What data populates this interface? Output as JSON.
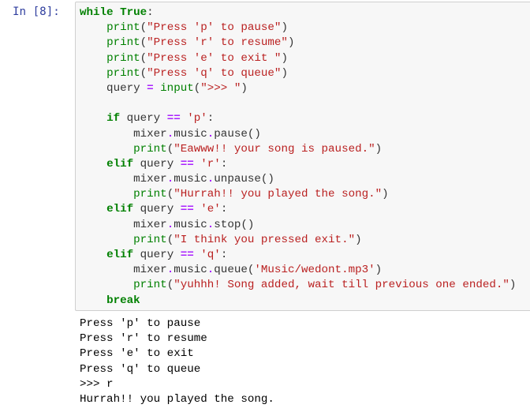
{
  "cell": {
    "prompt": "In [8]:",
    "code_lines": [
      [
        {
          "t": "kw",
          "v": "while"
        },
        {
          "t": "tx",
          "v": " "
        },
        {
          "t": "kw",
          "v": "True"
        },
        {
          "t": "tx",
          "v": ":"
        }
      ],
      [
        {
          "t": "tx",
          "v": "    "
        },
        {
          "t": "bi",
          "v": "print"
        },
        {
          "t": "tx",
          "v": "("
        },
        {
          "t": "st",
          "v": "\"Press 'p' to pause\""
        },
        {
          "t": "tx",
          "v": ")"
        }
      ],
      [
        {
          "t": "tx",
          "v": "    "
        },
        {
          "t": "bi",
          "v": "print"
        },
        {
          "t": "tx",
          "v": "("
        },
        {
          "t": "st",
          "v": "\"Press 'r' to resume\""
        },
        {
          "t": "tx",
          "v": ")"
        }
      ],
      [
        {
          "t": "tx",
          "v": "    "
        },
        {
          "t": "bi",
          "v": "print"
        },
        {
          "t": "tx",
          "v": "("
        },
        {
          "t": "st",
          "v": "\"Press 'e' to exit \""
        },
        {
          "t": "tx",
          "v": ")"
        }
      ],
      [
        {
          "t": "tx",
          "v": "    "
        },
        {
          "t": "bi",
          "v": "print"
        },
        {
          "t": "tx",
          "v": "("
        },
        {
          "t": "st",
          "v": "\"Press 'q' to queue\""
        },
        {
          "t": "tx",
          "v": ")"
        }
      ],
      [
        {
          "t": "tx",
          "v": "    query "
        },
        {
          "t": "op",
          "v": "="
        },
        {
          "t": "tx",
          "v": " "
        },
        {
          "t": "bi",
          "v": "input"
        },
        {
          "t": "tx",
          "v": "("
        },
        {
          "t": "st",
          "v": "\">>> \""
        },
        {
          "t": "tx",
          "v": ")"
        }
      ],
      [
        {
          "t": "tx",
          "v": " "
        }
      ],
      [
        {
          "t": "tx",
          "v": "    "
        },
        {
          "t": "kw",
          "v": "if"
        },
        {
          "t": "tx",
          "v": " query "
        },
        {
          "t": "op",
          "v": "=="
        },
        {
          "t": "tx",
          "v": " "
        },
        {
          "t": "st",
          "v": "'p'"
        },
        {
          "t": "tx",
          "v": ":"
        }
      ],
      [
        {
          "t": "tx",
          "v": "        mixer"
        },
        {
          "t": "op",
          "v": "."
        },
        {
          "t": "tx",
          "v": "music"
        },
        {
          "t": "op",
          "v": "."
        },
        {
          "t": "tx",
          "v": "pause()"
        }
      ],
      [
        {
          "t": "tx",
          "v": "        "
        },
        {
          "t": "bi",
          "v": "print"
        },
        {
          "t": "tx",
          "v": "("
        },
        {
          "t": "st",
          "v": "\"Eawww!! your song is paused.\""
        },
        {
          "t": "tx",
          "v": ")"
        }
      ],
      [
        {
          "t": "tx",
          "v": "    "
        },
        {
          "t": "kw",
          "v": "elif"
        },
        {
          "t": "tx",
          "v": " query "
        },
        {
          "t": "op",
          "v": "=="
        },
        {
          "t": "tx",
          "v": " "
        },
        {
          "t": "st",
          "v": "'r'"
        },
        {
          "t": "tx",
          "v": ":"
        }
      ],
      [
        {
          "t": "tx",
          "v": "        mixer"
        },
        {
          "t": "op",
          "v": "."
        },
        {
          "t": "tx",
          "v": "music"
        },
        {
          "t": "op",
          "v": "."
        },
        {
          "t": "tx",
          "v": "unpause()"
        }
      ],
      [
        {
          "t": "tx",
          "v": "        "
        },
        {
          "t": "bi",
          "v": "print"
        },
        {
          "t": "tx",
          "v": "("
        },
        {
          "t": "st",
          "v": "\"Hurrah!! you played the song.\""
        },
        {
          "t": "tx",
          "v": ")"
        }
      ],
      [
        {
          "t": "tx",
          "v": "    "
        },
        {
          "t": "kw",
          "v": "elif"
        },
        {
          "t": "tx",
          "v": " query "
        },
        {
          "t": "op",
          "v": "=="
        },
        {
          "t": "tx",
          "v": " "
        },
        {
          "t": "st",
          "v": "'e'"
        },
        {
          "t": "tx",
          "v": ":"
        }
      ],
      [
        {
          "t": "tx",
          "v": "        mixer"
        },
        {
          "t": "op",
          "v": "."
        },
        {
          "t": "tx",
          "v": "music"
        },
        {
          "t": "op",
          "v": "."
        },
        {
          "t": "tx",
          "v": "stop()"
        }
      ],
      [
        {
          "t": "tx",
          "v": "        "
        },
        {
          "t": "bi",
          "v": "print"
        },
        {
          "t": "tx",
          "v": "("
        },
        {
          "t": "st",
          "v": "\"I think you pressed exit.\""
        },
        {
          "t": "tx",
          "v": ")"
        }
      ],
      [
        {
          "t": "tx",
          "v": "    "
        },
        {
          "t": "kw",
          "v": "elif"
        },
        {
          "t": "tx",
          "v": " query "
        },
        {
          "t": "op",
          "v": "=="
        },
        {
          "t": "tx",
          "v": " "
        },
        {
          "t": "st",
          "v": "'q'"
        },
        {
          "t": "tx",
          "v": ":"
        }
      ],
      [
        {
          "t": "tx",
          "v": "        mixer"
        },
        {
          "t": "op",
          "v": "."
        },
        {
          "t": "tx",
          "v": "music"
        },
        {
          "t": "op",
          "v": "."
        },
        {
          "t": "tx",
          "v": "queue("
        },
        {
          "t": "st",
          "v": "'Music/wedont.mp3'"
        },
        {
          "t": "tx",
          "v": ")"
        }
      ],
      [
        {
          "t": "tx",
          "v": "        "
        },
        {
          "t": "bi",
          "v": "print"
        },
        {
          "t": "tx",
          "v": "("
        },
        {
          "t": "st",
          "v": "\"yuhhh! Song added, wait till previous one ended.\""
        },
        {
          "t": "tx",
          "v": ")"
        }
      ],
      [
        {
          "t": "tx",
          "v": "    "
        },
        {
          "t": "kw",
          "v": "break"
        }
      ]
    ],
    "output_lines": [
      "Press 'p' to pause",
      "Press 'r' to resume",
      "Press 'e' to exit",
      "Press 'q' to queue",
      ">>> r",
      "Hurrah!! you played the song."
    ]
  },
  "colors": {
    "prompt": "#303f9f",
    "keyword": "#008000",
    "string": "#ba2121",
    "operator": "#aa22ff",
    "cell_background": "#f7f7f7",
    "cell_border": "#cfcfcf"
  }
}
